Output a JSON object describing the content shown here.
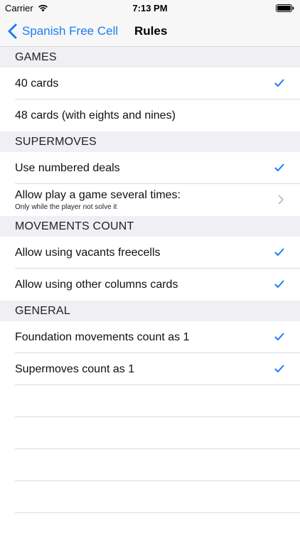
{
  "status_bar": {
    "carrier": "Carrier",
    "time": "7:13 PM"
  },
  "nav": {
    "back_label": "Spanish Free Cell",
    "title": "Rules"
  },
  "colors": {
    "accent": "#1a7cf5",
    "section_bg": "#efeff4",
    "nav_bg": "#f7f7f7"
  },
  "sections": [
    {
      "header": "GAMES",
      "rows": [
        {
          "label": "40 cards",
          "accessory": "checkmark-icon"
        },
        {
          "label": "48 cards (with eights and nines)",
          "accessory": "none"
        }
      ]
    },
    {
      "header": "SUPERMOVES",
      "rows": [
        {
          "label": "Use numbered deals",
          "accessory": "checkmark-icon"
        },
        {
          "label": "Allow play a game several times:",
          "subtitle": "Only while the player not solve it",
          "accessory": "chevron-right-icon"
        }
      ]
    },
    {
      "header": "MOVEMENTS COUNT",
      "rows": [
        {
          "label": "Allow using vacants freecells",
          "accessory": "checkmark-icon"
        },
        {
          "label": "Allow using other columns cards",
          "accessory": "checkmark-icon"
        }
      ]
    },
    {
      "header": "GENERAL",
      "rows": [
        {
          "label": "Foundation movements count as 1",
          "accessory": "checkmark-icon"
        },
        {
          "label": "Supermoves count as 1",
          "accessory": "checkmark-icon"
        }
      ]
    }
  ]
}
